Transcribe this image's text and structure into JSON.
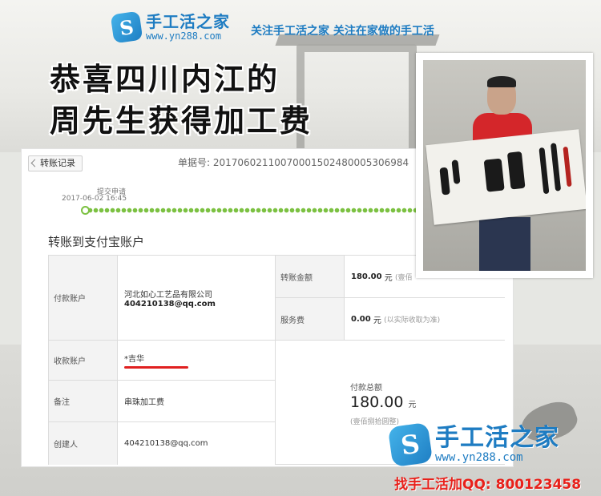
{
  "header": {
    "logo_glyph": "S",
    "logo_title": "手工活之家",
    "logo_url": "www.yn288.com",
    "slogan": "关注手工活之家  关注在家做的手工活"
  },
  "headline": {
    "line1": "恭喜四川内江的",
    "line2": "周先生获得加工费"
  },
  "receipt": {
    "back_label": "转账记录",
    "doc_number": "单据号: 20170602110070001502480005306984",
    "step_label": "提交申请",
    "step_time": "2017-06-02 16:45",
    "section_title": "转账到支付宝账户",
    "payer_label": "付款账户",
    "payer_company": "河北如心工艺品有限公司",
    "payer_email": "404210138@qq.com",
    "transfer_amount_label": "转账金额",
    "transfer_amount": "180.00",
    "transfer_amount_unit": "元",
    "transfer_amount_note": "(壹佰",
    "fee_label": "服务费",
    "fee": "0.00",
    "fee_unit": "元",
    "fee_note": "(以实际收取为准)",
    "payee_label": "收款账户",
    "payee_name": "*吉华",
    "memo_label": "备注",
    "memo": "串珠加工费",
    "creator_label": "创建人",
    "creator": "404210138@qq.com",
    "total_label": "付款总额",
    "total": "180.00",
    "total_unit": "元",
    "total_words": "(壹佰捌拾圆整)"
  },
  "footer": {
    "logo_title": "手工活之家",
    "logo_url": "www.yn288.com",
    "contact": "找手工活加QQ: 800123458"
  },
  "colors": {
    "brand_blue": "#1e7cc2",
    "progress_green": "#7cc142",
    "contact_red": "#e8201a"
  }
}
